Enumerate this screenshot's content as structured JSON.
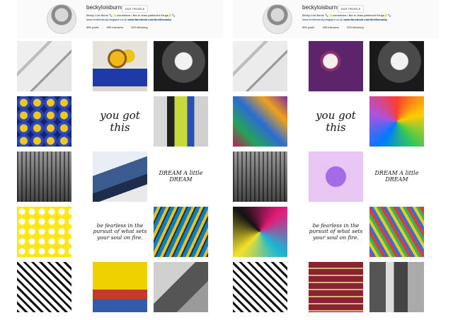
{
  "panels": [
    {
      "username": "beckyloisburns",
      "edit_label": "EDIT PROFILE",
      "bio": "Becky Lois Burns 🐾 🌟sometimes I like to draw patterned things🌟🐾",
      "website": "www.textilecandy.blogspot.co.uk",
      "facebook": "www.facebook.com/textilecandy",
      "posts": "856 posts",
      "followers": "359 followers",
      "following": "525 following",
      "tiles": [
        {
          "name": "photo-sketch-hand"
        },
        {
          "name": "photo-sunflowers"
        },
        {
          "name": "photo-bw-portrait"
        },
        {
          "name": "photo-blue-tiles"
        },
        {
          "name": "quote-you-got-this",
          "text": "you got this"
        },
        {
          "name": "photo-fashion-runway"
        },
        {
          "name": "photo-station-roof"
        },
        {
          "name": "photo-denim"
        },
        {
          "name": "illustration-dream-a-little",
          "text": "DREAM A little DREAM"
        },
        {
          "name": "photo-yellow-pattern"
        },
        {
          "name": "quote-be-fearless",
          "text": "be fearless in the pursuit of what sets your soul on fire."
        },
        {
          "name": "photo-fish"
        },
        {
          "name": "photo-geometric"
        },
        {
          "name": "photo-colorful-room"
        },
        {
          "name": "photo-bw-photos"
        }
      ]
    },
    {
      "username": "beckyloisburns",
      "edit_label": "EDIT PROFILE",
      "bio": "Becky Lois Burns 🐾 🌟sometimes I like to draw patterned things🌟🐾",
      "website": "www.textilecandy.blogspot.co.uk",
      "facebook": "www.facebook.com/textilecandy",
      "posts": "856 posts",
      "followers": "359 followers",
      "following": "525 following",
      "tiles": [
        {
          "name": "photo-sketch-hand"
        },
        {
          "name": "photo-cupcakes"
        },
        {
          "name": "photo-bw-portrait"
        },
        {
          "name": "photo-colorful-pattern"
        },
        {
          "name": "quote-you-got-this",
          "text": "you got this"
        },
        {
          "name": "photo-pop-art-face"
        },
        {
          "name": "photo-station-roof"
        },
        {
          "name": "photo-popsicle"
        },
        {
          "name": "illustration-dream-a-little",
          "text": "DREAM A little DREAM"
        },
        {
          "name": "photo-kaleidoscope"
        },
        {
          "name": "quote-be-fearless",
          "text": "be fearless in the pursuit of what sets your soul on fire."
        },
        {
          "name": "photo-colored-pencils"
        },
        {
          "name": "photo-geometric"
        },
        {
          "name": "photo-bookshelves"
        },
        {
          "name": "photo-bw-photos"
        }
      ]
    }
  ]
}
